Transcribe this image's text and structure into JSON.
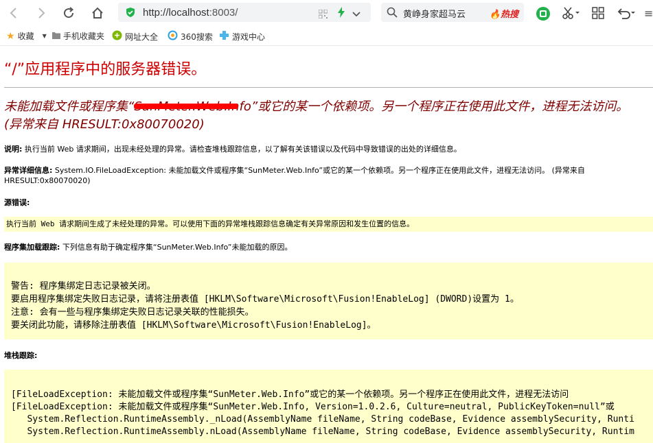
{
  "browser": {
    "url_host": "http://localhost",
    "url_port": ":8003/",
    "search_query": "黄峥身家超马云",
    "hot_label": "热搜",
    "bookmarks": [
      "收藏",
      "手机收藏夹",
      "网址大全",
      "360搜索",
      "游戏中心"
    ]
  },
  "page": {
    "title": "“/”应用程序中的服务器错误。",
    "subtitle_prefix": "未能加载文件或程序集“",
    "subtitle_redacted": "SunMeter.Web.In",
    "subtitle_suffix": "fo”或它的某一个依赖项。另一个程序正在使用此文件，进程无法访问。 (异常来自 HRESULT:0x80070020)",
    "description_label": "说明:",
    "description_text": " 执行当前 Web 请求期间，出现未经处理的异常。请检查堆栈跟踪信息，以了解有关该错误以及代码中导致错误的出处的详细信息。",
    "exception_label": "异常详细信息:",
    "exception_text": " System.IO.FileLoadException: 未能加载文件或程序集“SunMeter.Web.Info”或它的某一个依赖项。另一个程序正在使用此文件，进程无法访问。 (异常来自 HRESULT:0x80070020)",
    "source_error_label": "源错误:",
    "source_error_text": "执行当前 Web 请求期间生成了未经处理的异常。可以使用下面的异常堆栈跟踪信息确定有关异常原因和发生位置的信息。",
    "assembly_trace_label": "程序集加载跟踪:",
    "assembly_trace_text": " 下列信息有助于确定程序集“SunMeter.Web.Info”未能加载的原因。",
    "assembly_log_lines": [
      "警告: 程序集绑定日志记录被关闭。",
      "要启用程序集绑定失败日志记录，请将注册表值 [HKLM\\Software\\Microsoft\\Fusion!EnableLog] (DWORD)设置为 1。",
      "注意: 会有一些与程序集绑定失败日志记录关联的性能损失。",
      "要关闭此功能，请移除注册表值 [HKLM\\Software\\Microsoft\\Fusion!EnableLog]。"
    ],
    "stack_trace_label": "堆栈跟踪:",
    "stack_lines": [
      "[FileLoadException: 未能加载文件或程序集“SunMeter.Web.Info”或它的某一个依赖项。另一个程序正在使用此文件，进程无法访问",
      "",
      "[FileLoadException: 未能加载文件或程序集“SunMeter.Web.Info, Version=1.0.2.6, Culture=neutral, PublicKeyToken=null”或",
      "   System.Reflection.RuntimeAssembly._nLoad(AssemblyName fileName, String codeBase, Evidence assemblySecurity, Runti",
      "   System.Reflection.RuntimeAssembly.nLoad(AssemblyName fileName, String codeBase, Evidence assemblySecurity, Runtim"
    ]
  }
}
